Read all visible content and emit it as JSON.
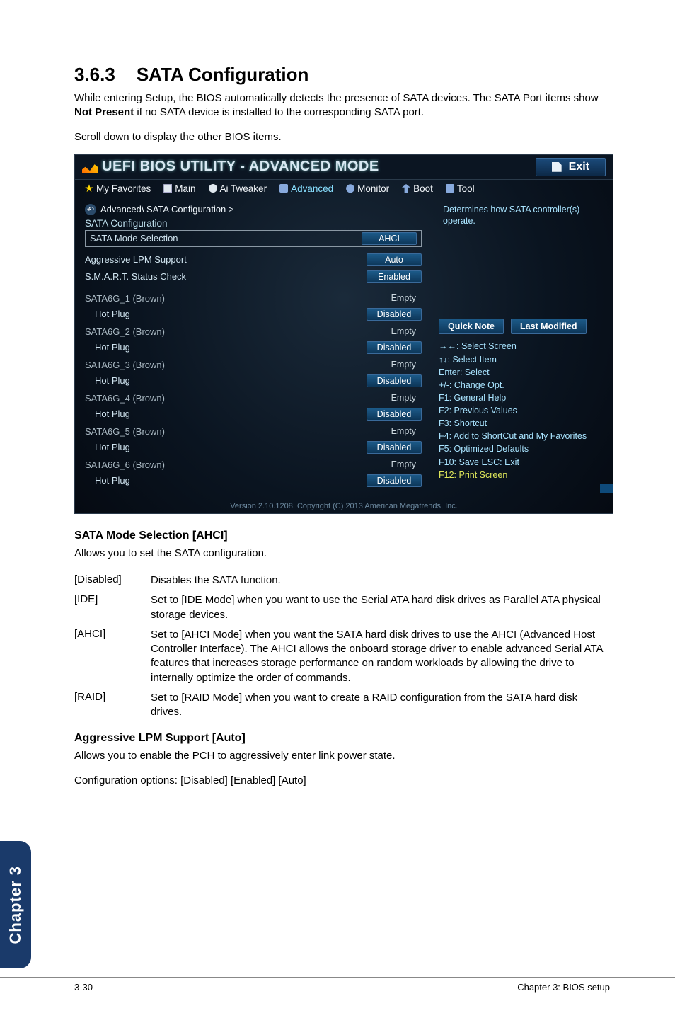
{
  "section": {
    "number": "3.6.3",
    "title": "SATA Configuration"
  },
  "intro": {
    "p1a": "While entering Setup, the BIOS automatically detects the presence of SATA devices. The SATA Port items show ",
    "p1b": "Not Present",
    "p1c": " if no SATA device is installed to the corresponding SATA port.",
    "p2": "Scroll down to display the other BIOS items."
  },
  "bios": {
    "title": "UEFI BIOS UTILITY - ADVANCED MODE",
    "exit": "Exit",
    "tabs": {
      "fav": "My Favorites",
      "main": "Main",
      "tweaker": "Ai Tweaker",
      "advanced": "Advanced",
      "monitor": "Monitor",
      "boot": "Boot",
      "tool": "Tool"
    },
    "crumb": "Advanced\\ SATA Configuration >",
    "hdr": "SATA Configuration",
    "rows": {
      "mode": {
        "label": "SATA Mode Selection",
        "value": "AHCI"
      },
      "lpm": {
        "label": "Aggressive LPM Support",
        "value": "Auto"
      },
      "smart": {
        "label": "S.M.A.R.T. Status Check",
        "value": "Enabled"
      }
    },
    "ports": [
      {
        "name": "SATA6G_1 (Brown)",
        "hp": "Hot Plug",
        "state": "Empty",
        "hpv": "Disabled"
      },
      {
        "name": "SATA6G_2 (Brown)",
        "hp": "Hot Plug",
        "state": "Empty",
        "hpv": "Disabled"
      },
      {
        "name": "SATA6G_3 (Brown)",
        "hp": "Hot Plug",
        "state": "Empty",
        "hpv": "Disabled"
      },
      {
        "name": "SATA6G_4 (Brown)",
        "hp": "Hot Plug",
        "state": "Empty",
        "hpv": "Disabled"
      },
      {
        "name": "SATA6G_5 (Brown)",
        "hp": "Hot Plug",
        "state": "Empty",
        "hpv": "Disabled"
      },
      {
        "name": "SATA6G_6 (Brown)",
        "hp": "Hot Plug",
        "state": "Empty",
        "hpv": "Disabled"
      }
    ],
    "help": "Determines how SATA controller(s) operate.",
    "quicknote": "Quick Note",
    "lastmod": "Last Modified",
    "keys": {
      "k1": "→←: Select Screen",
      "k2": "↑↓: Select Item",
      "k3": "Enter: Select",
      "k4": "+/-: Change Opt.",
      "k5": "F1: General Help",
      "k6": "F2: Previous Values",
      "k7": "F3: Shortcut",
      "k8": "F4: Add to ShortCut and My Favorites",
      "k9": "F5: Optimized Defaults",
      "k10": "F10: Save  ESC: Exit",
      "k11": "F12: Print Screen"
    },
    "footer": "Version 2.10.1208. Copyright (C) 2013 American Megatrends, Inc."
  },
  "mode_section": {
    "title": "SATA Mode Selection [AHCI]",
    "lead": "Allows you to set the SATA configuration.",
    "opts": [
      {
        "t": "[Disabled]",
        "d": "Disables the SATA function."
      },
      {
        "t": "[IDE]",
        "d": "Set to [IDE Mode] when you want to use the Serial ATA hard disk drives as Parallel ATA physical storage devices."
      },
      {
        "t": "[AHCI]",
        "d": "Set to [AHCI Mode] when you want the SATA hard disk drives to use the AHCI (Advanced Host Controller Interface). The AHCI allows the onboard storage driver to enable advanced Serial ATA features that increases storage performance on random workloads by allowing the drive to internally optimize the order of commands."
      },
      {
        "t": "[RAID]",
        "d": "Set to [RAID Mode] when you want to create a RAID configuration from the SATA hard disk drives."
      }
    ]
  },
  "lpm_section": {
    "title": "Aggressive LPM Support [Auto]",
    "p1": "Allows you to enable the PCH to aggressively enter link power state.",
    "p2": "Configuration options: [Disabled] [Enabled] [Auto]"
  },
  "sidebar": "Chapter 3",
  "footer": {
    "left": "3-30",
    "right": "Chapter 3: BIOS setup"
  }
}
